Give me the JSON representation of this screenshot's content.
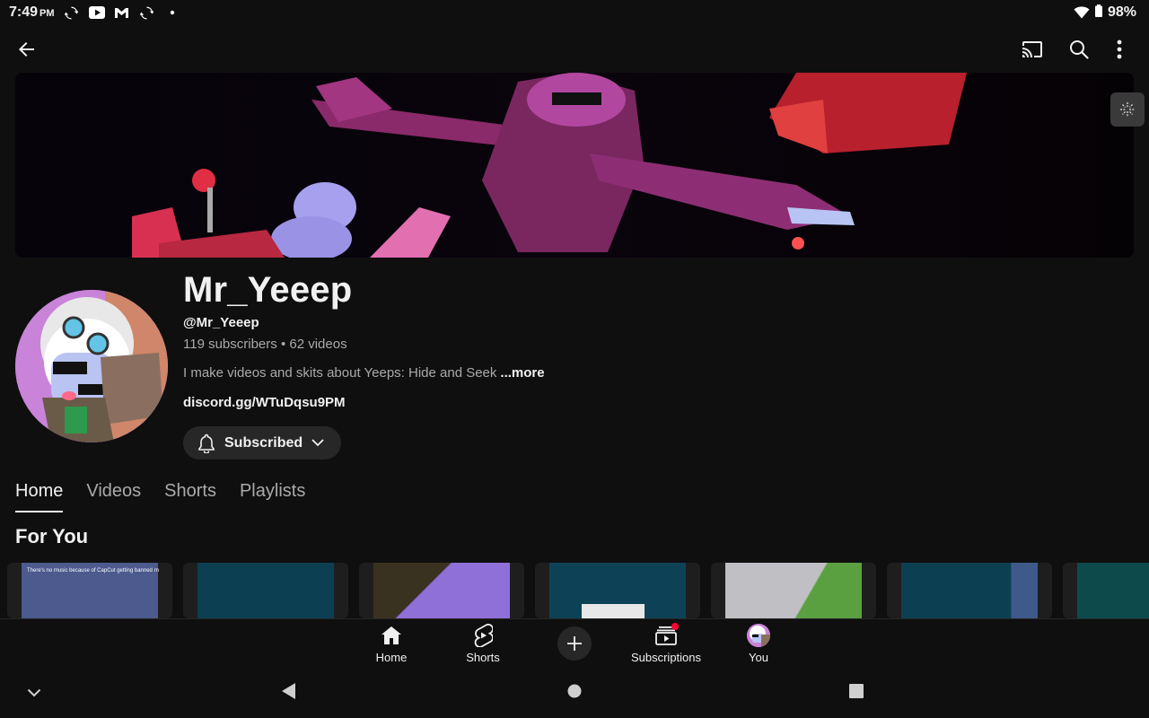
{
  "status_bar": {
    "time": "7:49",
    "ampm": "PM",
    "battery": "98%",
    "icons": [
      "sync-icon",
      "youtube-icon",
      "gmail-icon",
      "sync-icon",
      "dot-icon",
      "wifi-icon",
      "battery-icon"
    ]
  },
  "top_bar": {
    "icons": [
      "back-arrow-icon",
      "cast-icon",
      "search-icon",
      "more-vert-icon"
    ]
  },
  "channel": {
    "name": "Mr_Yeeep",
    "handle": "@Mr_Yeeep",
    "stats": "119 subscribers • 62 videos",
    "description": "I make videos and skits about Yeeps: Hide and Seek",
    "more_label": "...more",
    "link": "discord.gg/WTuDqsu9PM",
    "subscribed_label": "Subscribed"
  },
  "tabs": [
    {
      "label": "Home",
      "active": true
    },
    {
      "label": "Videos",
      "active": false
    },
    {
      "label": "Shorts",
      "active": false
    },
    {
      "label": "Playlists",
      "active": false
    }
  ],
  "section_title": "For You",
  "thumbnails": {
    "first_caption": "There's no music because of CapCut getting banned rn"
  },
  "bottom_nav": {
    "home": "Home",
    "shorts": "Shorts",
    "subscriptions": "Subscriptions",
    "you": "You"
  },
  "colors": {
    "background": "#0f0f0f",
    "chip": "#272727",
    "text_secondary": "#aaaaaa",
    "notification": "#ff0033"
  }
}
